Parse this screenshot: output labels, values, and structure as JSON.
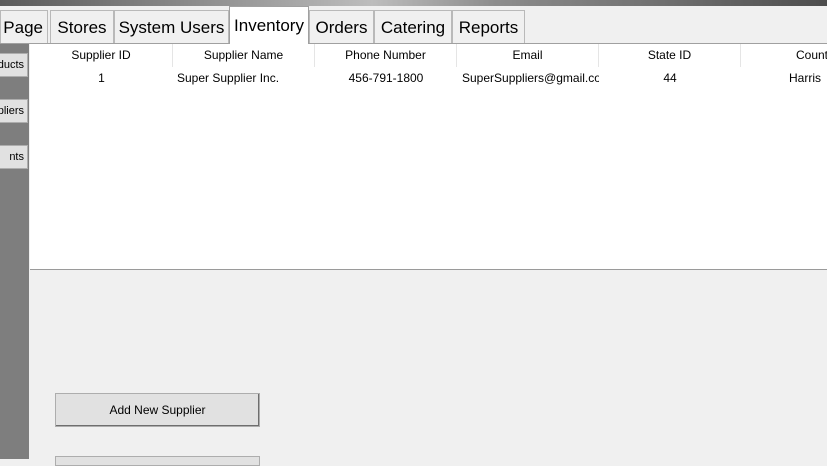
{
  "tabs": [
    {
      "label": "Page"
    },
    {
      "label": "Stores"
    },
    {
      "label": "System Users"
    },
    {
      "label": "Inventory"
    },
    {
      "label": "Orders"
    },
    {
      "label": "Catering"
    },
    {
      "label": "Reports"
    }
  ],
  "active_tab": "Inventory",
  "side_buttons": [
    {
      "label": "ducts"
    },
    {
      "label": "pliers"
    },
    {
      "label": "nts"
    }
  ],
  "table": {
    "columns": [
      "Supplier ID",
      "Supplier Name",
      "Phone Number",
      "Email",
      "State ID",
      "Count"
    ],
    "rows": [
      [
        "1",
        "Super Supplier Inc.",
        "456-791-1800",
        "SuperSuppliers@gmail.co",
        "44",
        "Harris"
      ]
    ]
  },
  "actions": {
    "add_supplier_label": "Add New Supplier"
  }
}
